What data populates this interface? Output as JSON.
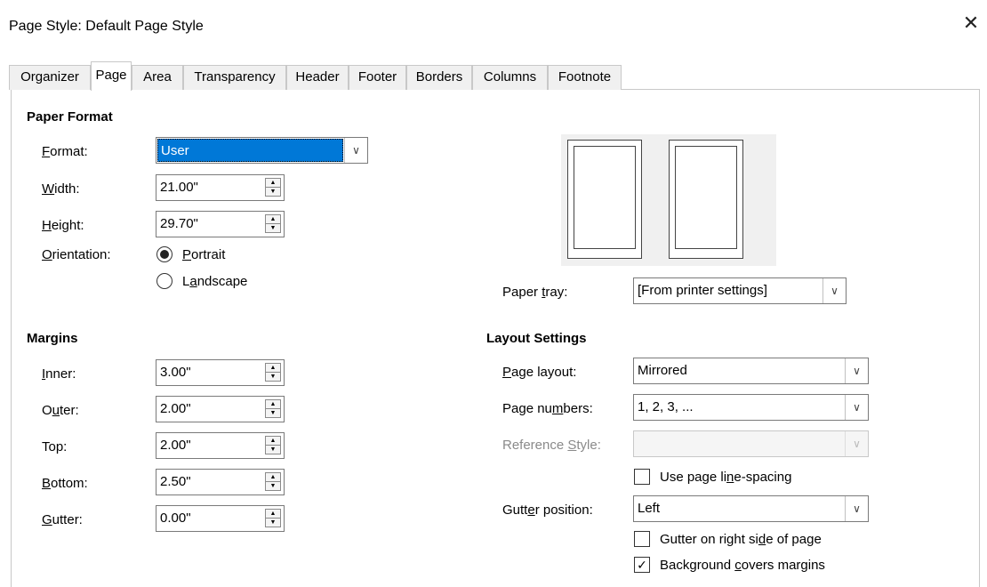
{
  "window": {
    "title": "Page Style: Default Page Style"
  },
  "tabs": [
    "Organizer",
    "Page",
    "Area",
    "Transparency",
    "Header",
    "Footer",
    "Borders",
    "Columns",
    "Footnote"
  ],
  "paper_format": {
    "heading": "Paper Format",
    "format": {
      "label": "Format:",
      "value": "User"
    },
    "width": {
      "label": "Width:",
      "value": "21.00\""
    },
    "height": {
      "label": "Height:",
      "value": "29.70\""
    },
    "orientation": {
      "label": "Orientation:",
      "portrait": "Portrait",
      "landscape": "Landscape",
      "selected": "Portrait"
    },
    "paper_tray": {
      "label": "Paper tray:",
      "value": "[From printer settings]"
    }
  },
  "margins": {
    "heading": "Margins",
    "inner": {
      "label": "Inner:",
      "value": "3.00\""
    },
    "outer": {
      "label": "Outer:",
      "value": "2.00\""
    },
    "top": {
      "label": "Top:",
      "value": "2.00\""
    },
    "bottom": {
      "label": "Bottom:",
      "value": "2.50\""
    },
    "gutter": {
      "label": "Gutter:",
      "value": "0.00\""
    }
  },
  "layout_settings": {
    "heading": "Layout Settings",
    "page_layout": {
      "label": "Page layout:",
      "value": "Mirrored"
    },
    "page_numbers": {
      "label": "Page numbers:",
      "value": "1, 2, 3, ..."
    },
    "reference_style": {
      "label": "Reference Style:",
      "value": ""
    },
    "use_page_line_spacing": {
      "label": "Use page line-spacing",
      "checked": false
    },
    "gutter_position": {
      "label": "Gutter position:",
      "value": "Left"
    },
    "gutter_right_side": {
      "label": "Gutter on right side of page",
      "checked": false
    },
    "background_covers_margins": {
      "label": "Background covers margins",
      "checked": true
    }
  },
  "icons": {
    "close": "close-icon",
    "dropdown": "chevron-down-icon",
    "spin": "spin-arrows-icon"
  }
}
